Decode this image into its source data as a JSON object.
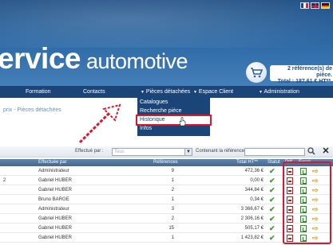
{
  "header": {
    "brand_bold": "ervice",
    "brand_light": "automotive",
    "flags": [
      "fr-flag",
      "uk-flag",
      "de-flag"
    ],
    "cart_line1": "2 référence(s) de pièce.",
    "cart_line2": "Total : 187,61 € HT**.",
    "colors": {
      "primary": "#1b4578",
      "accent_red": "#d9182d"
    }
  },
  "nav": {
    "items": [
      "Formation",
      "Contacts",
      "Pièces détachées",
      "Espace Client",
      "Administration"
    ],
    "dropdown": [
      "Catalogues",
      "Recherche pièce",
      "Historique",
      "Infos"
    ],
    "active_dropdown": "Historique"
  },
  "breadcrumb": "prix - Pièces détachées",
  "filter": {
    "effectue_label": "Effectué par :",
    "select_value": "Tous",
    "ref_label": "Contenant la référence :"
  },
  "table": {
    "headers": [
      "Effectuée par",
      "Références",
      "Total HT**",
      "Statut",
      "Pdf",
      "Excel"
    ],
    "rows": [
      {
        "lead": "",
        "by": "Administrateur",
        "refs": "9",
        "total": "472,36 €"
      },
      {
        "lead": "2",
        "by": "Gabriel HUBER",
        "refs": "1",
        "total": "0,00 €"
      },
      {
        "lead": "",
        "by": "Gabriel HUBER",
        "refs": "2",
        "total": "344,84 €"
      },
      {
        "lead": "",
        "by": "Bruno BARGE",
        "refs": "1",
        "total": "0,34 €"
      },
      {
        "lead": "",
        "by": "Administrateur",
        "refs": "3",
        "total": "3 366,67 €"
      },
      {
        "lead": "",
        "by": "Gabriel HUBER",
        "refs": "2",
        "total": "2 306,16 €"
      },
      {
        "lead": "",
        "by": "Gabriel HUBER",
        "refs": "15",
        "total": "505,17 €"
      },
      {
        "lead": "",
        "by": "Gabriel HUBER",
        "refs": "1",
        "total": "1 423,82 €"
      }
    ]
  }
}
